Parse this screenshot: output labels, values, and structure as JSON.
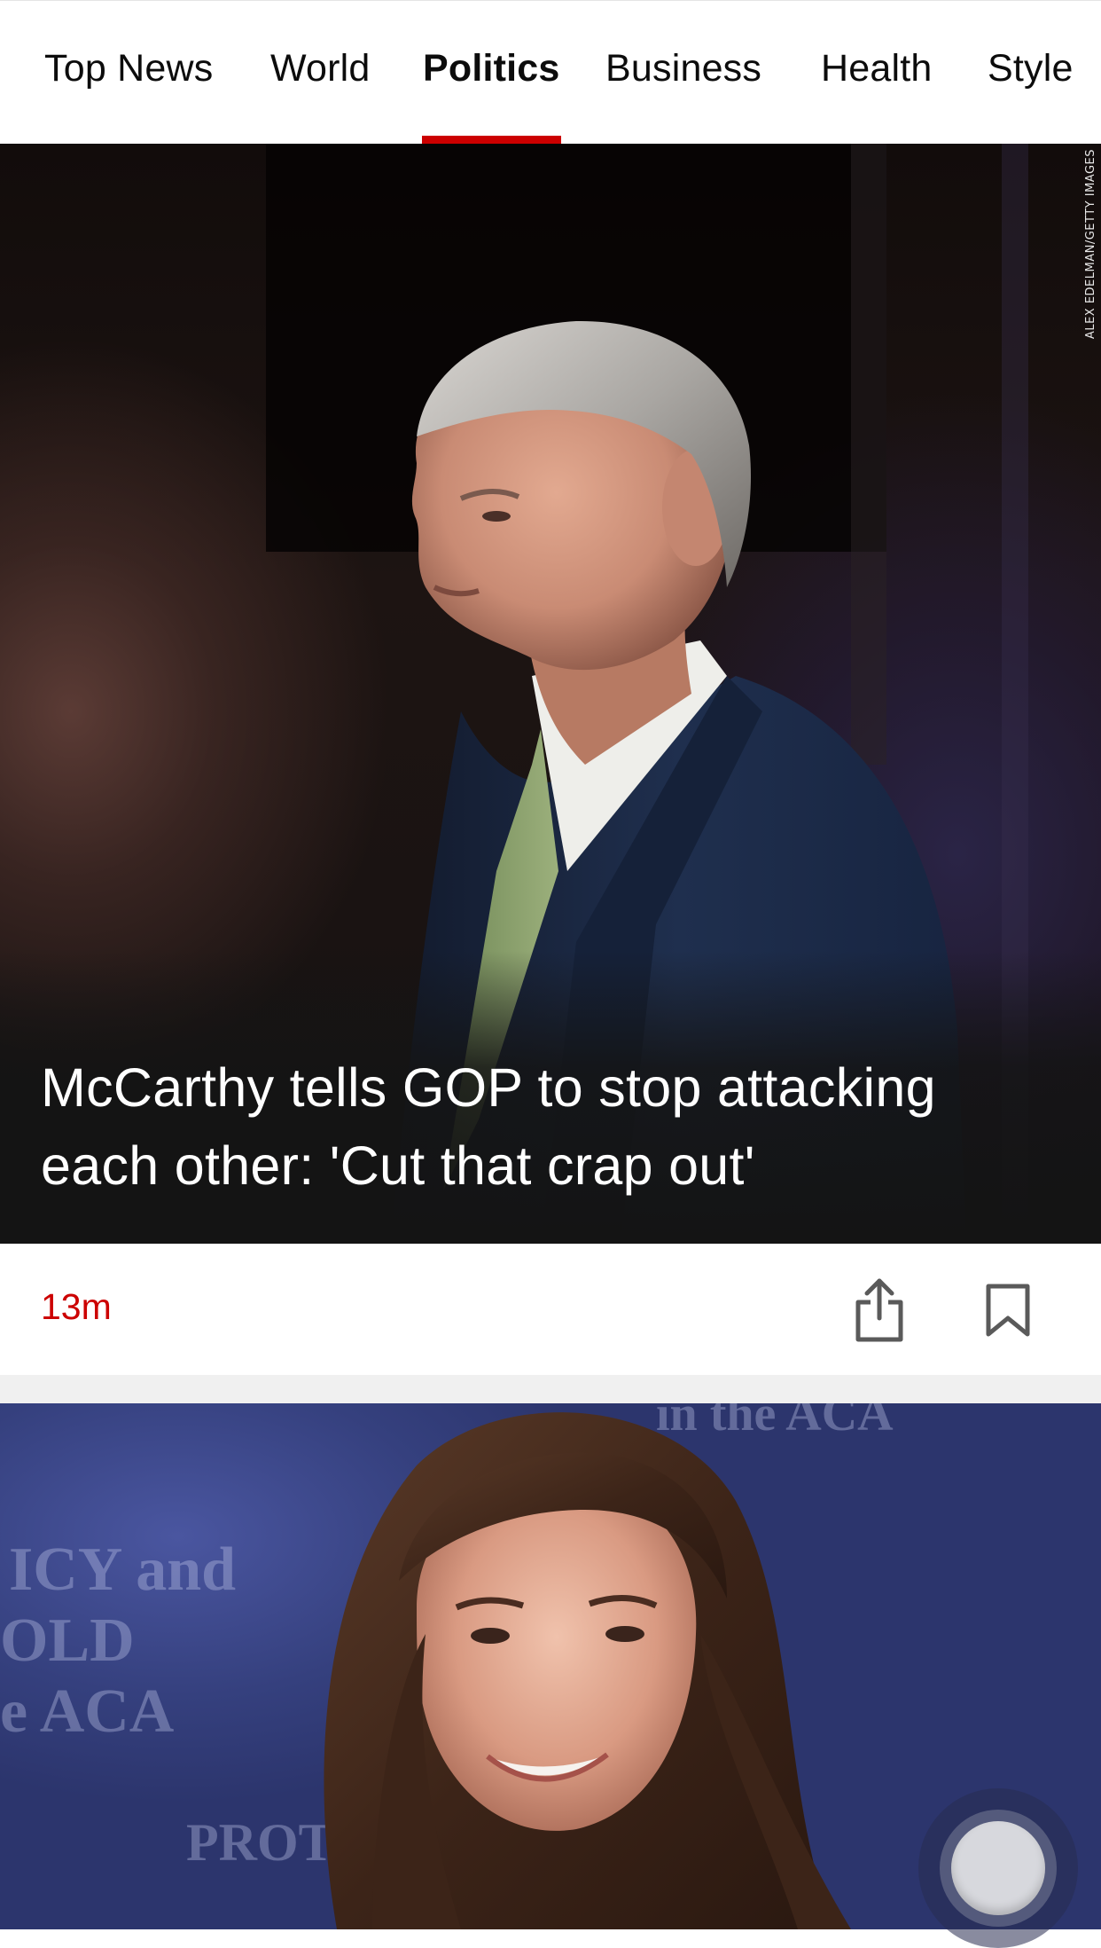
{
  "nav": {
    "tabs": [
      {
        "label": "Top News",
        "active": false
      },
      {
        "label": "World",
        "active": false
      },
      {
        "label": "Politics",
        "active": true
      },
      {
        "label": "Business",
        "active": false
      },
      {
        "label": "Health",
        "active": false
      },
      {
        "label": "Style",
        "active": false
      }
    ],
    "active_color": "#cc0000"
  },
  "hero": {
    "headline": "McCarthy tells GOP to stop attacking each other: 'Cut that crap out'",
    "photo_credit": "ALEX EDELMAN/GETTY IMAGES",
    "timestamp": "13m",
    "share_icon": "share-icon",
    "bookmark_icon": "bookmark-icon"
  },
  "story2": {
    "background_text": [
      "ICY and",
      "OLD",
      "e ACA",
      "in the ACA",
      "PROTE"
    ]
  },
  "fab": {
    "icon": "assistive-touch-icon"
  }
}
